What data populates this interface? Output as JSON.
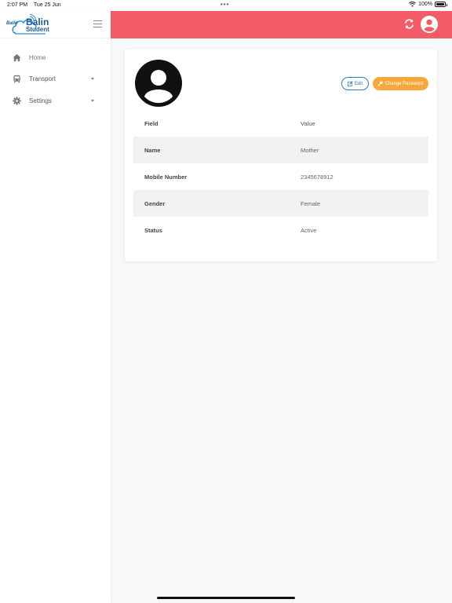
{
  "status_bar": {
    "time": "2:07 PM",
    "date": "Tue 25 Jun",
    "battery": "100%"
  },
  "brand": {
    "name_line1": "Balin",
    "name_line2": "Student",
    "mini": "Balin"
  },
  "sidebar": {
    "items": [
      {
        "label": "Home",
        "icon": "home-icon"
      },
      {
        "label": "Transport",
        "icon": "bus-icon"
      },
      {
        "label": "Settings",
        "icon": "gear-icon"
      }
    ]
  },
  "colors": {
    "topbar": "#f25c67",
    "edit": "#2e7bc4",
    "change_password": "#f8a83b"
  },
  "profile": {
    "edit_label": "Edit",
    "change_password_label": "Change Password",
    "table": {
      "headers": [
        "Field",
        "Value"
      ],
      "rows": [
        [
          "Name",
          "Mother"
        ],
        [
          "Mobile Number",
          "2345678912"
        ],
        [
          "Gender",
          "Female"
        ],
        [
          "Status",
          "Active"
        ]
      ]
    }
  }
}
